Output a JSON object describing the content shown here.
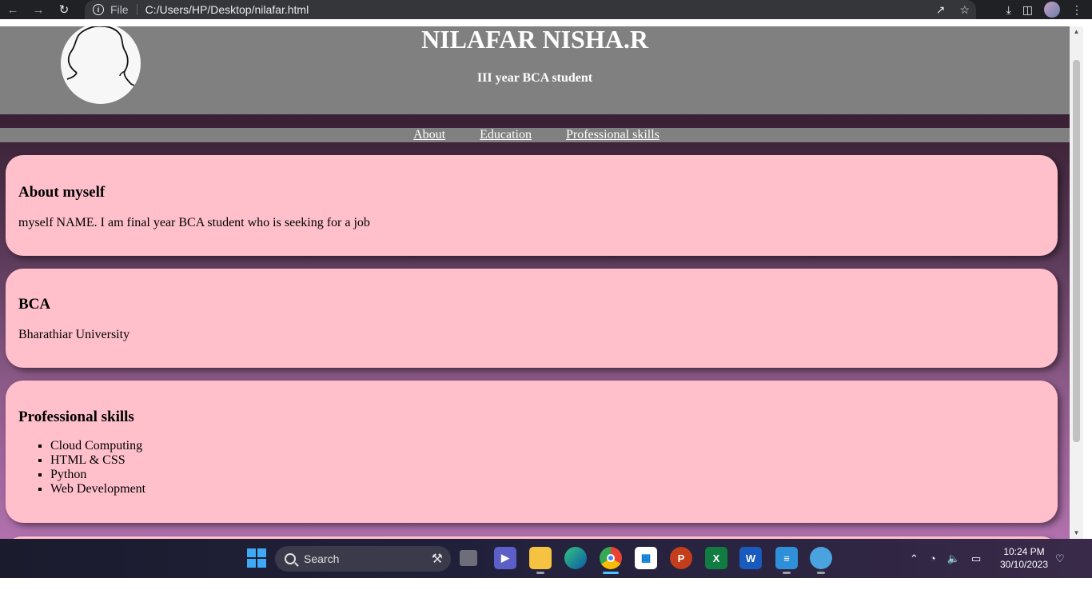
{
  "browser": {
    "file_label": "File",
    "url": "C:/Users/HP/Desktop/nilafar.html"
  },
  "header": {
    "name": "NILAFAR NISHA.R",
    "subtitle": "III year BCA student"
  },
  "nav": {
    "items": [
      "About",
      "Education",
      "Professional skills"
    ]
  },
  "about": {
    "heading": "About myself",
    "text": "myself NAME. I am final year BCA student who is seeking for a job"
  },
  "education": {
    "heading": "BCA",
    "text": "Bharathiar University"
  },
  "skills": {
    "heading": "Professional skills",
    "items": [
      "Cloud Computing",
      "HTML & CSS",
      "Python",
      "Web Development"
    ]
  },
  "taskbar": {
    "search_placeholder": "Search",
    "time": "10:24 PM",
    "date": "30/10/2023"
  },
  "colors": {
    "card_bg": "#ffc0cb",
    "header_bg": "#808080"
  }
}
